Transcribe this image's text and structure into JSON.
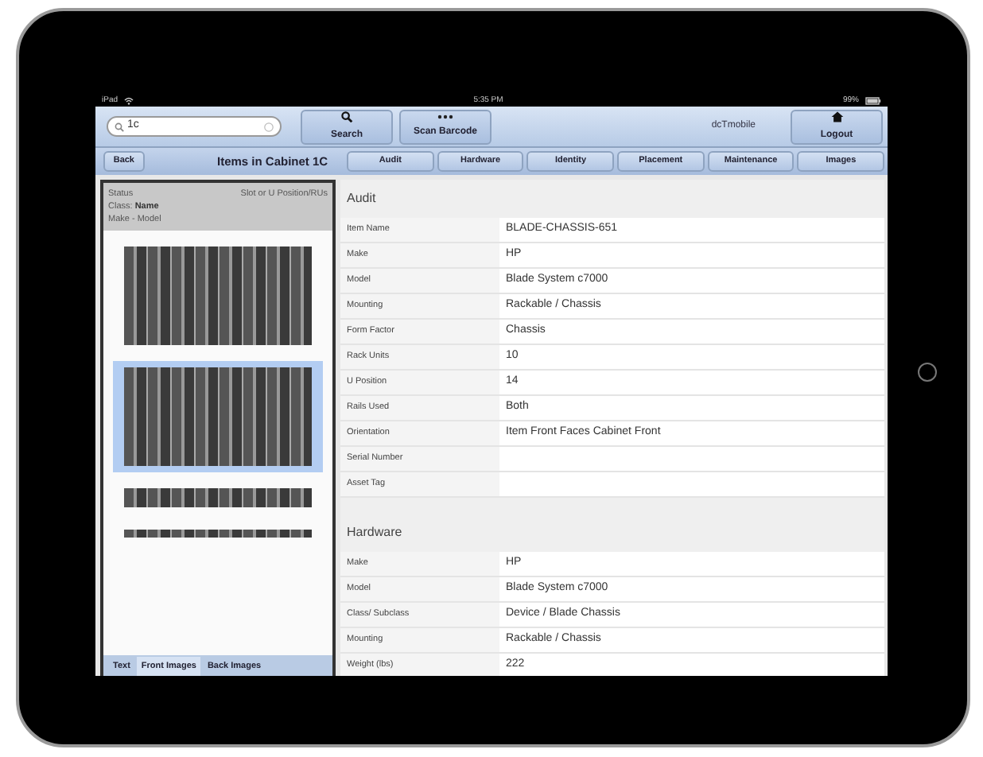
{
  "status_bar": {
    "carrier": "iPad",
    "time": "5:35 PM",
    "battery": "99%"
  },
  "toolbar": {
    "search": {
      "value": "1c"
    },
    "buttons": [
      {
        "label": "Search",
        "kind": "search"
      },
      {
        "label": "Scan Barcode",
        "kind": "dots"
      }
    ],
    "user": "dcTmobile",
    "logout": {
      "label": "Logout"
    }
  },
  "navbar": {
    "back": "Back",
    "title": "Items in Cabinet 1C",
    "tabs": [
      {
        "label": "Audit"
      },
      {
        "label": "Hardware"
      },
      {
        "label": "Identity"
      },
      {
        "label": "Placement"
      },
      {
        "label": "Maintenance"
      },
      {
        "label": "Images"
      }
    ]
  },
  "sidebar": {
    "header": {
      "status": "Status",
      "slot": "Slot or U Position/RUs",
      "class_prefix": "Class:",
      "class_name": "Name",
      "make_model": "Make - Model"
    },
    "images": [
      {
        "kind": "chassis",
        "selected": false
      },
      {
        "kind": "chassis",
        "selected": true
      },
      {
        "kind": "server",
        "selected": false
      },
      {
        "kind": "strip",
        "selected": false
      }
    ],
    "tabs": [
      {
        "label": "Text",
        "selected": false
      },
      {
        "label": "Front Images",
        "selected": true
      },
      {
        "label": "Back Images",
        "selected": false
      }
    ]
  },
  "sections": [
    {
      "title": "Audit",
      "rows": [
        {
          "label": "Item Name",
          "value": "BLADE-CHASSIS-651"
        },
        {
          "label": "Make",
          "value": "HP"
        },
        {
          "label": "Model",
          "value": "Blade System c7000"
        },
        {
          "label": "Mounting",
          "value": "Rackable / Chassis"
        },
        {
          "label": "Form Factor",
          "value": "Chassis"
        },
        {
          "label": "Rack Units",
          "value": "10"
        },
        {
          "label": "U Position",
          "value": "14"
        },
        {
          "label": "Rails Used",
          "value": "Both"
        },
        {
          "label": "Orientation",
          "value": "Item Front Faces Cabinet Front"
        },
        {
          "label": "Serial Number",
          "value": ""
        },
        {
          "label": "Asset Tag",
          "value": ""
        }
      ]
    },
    {
      "title": "Hardware",
      "rows": [
        {
          "label": "Make",
          "value": "HP"
        },
        {
          "label": "Model",
          "value": "Blade System c7000"
        },
        {
          "label": "Class/ Subclass",
          "value": "Device / Blade Chassis"
        },
        {
          "label": "Mounting",
          "value": "Rackable / Chassis"
        },
        {
          "label": "Weight (lbs)",
          "value": "222"
        }
      ]
    }
  ]
}
